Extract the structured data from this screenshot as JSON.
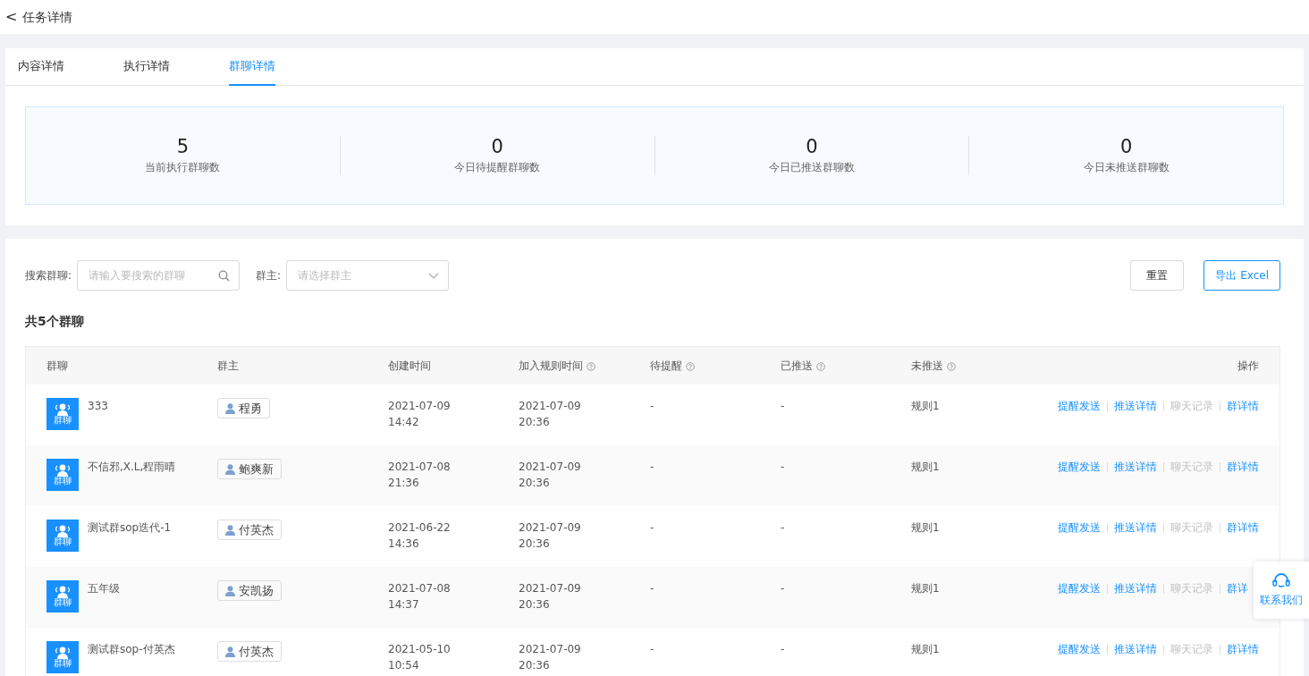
{
  "header": {
    "back_icon": "<",
    "title": "任务详情"
  },
  "tabs": [
    {
      "label": "内容详情",
      "selected": false
    },
    {
      "label": "执行详情",
      "selected": false
    },
    {
      "label": "群聊详情",
      "selected": true
    }
  ],
  "stats": [
    {
      "value": "5",
      "label": "当前执行群聊数"
    },
    {
      "value": "0",
      "label": "今日待提醒群聊数"
    },
    {
      "value": "0",
      "label": "今日已推送群聊数"
    },
    {
      "value": "0",
      "label": "今日未推送群聊数"
    }
  ],
  "filters": {
    "search_label": "搜索群聊:",
    "search_placeholder": "请输入要搜索的群聊",
    "owner_label": "群主:",
    "owner_placeholder": "请选择群主"
  },
  "buttons": [
    {
      "label": "重置",
      "kind": "default"
    },
    {
      "label": "导出 Excel",
      "kind": "outline"
    }
  ],
  "summary": "共5个群聊",
  "table": {
    "columns": [
      {
        "label": "群聊",
        "help": false
      },
      {
        "label": "群主",
        "help": false
      },
      {
        "label": "创建时间",
        "help": false
      },
      {
        "label": "加入规则时间",
        "help": true
      },
      {
        "label": "待提醒",
        "help": true
      },
      {
        "label": "已推送",
        "help": true
      },
      {
        "label": "未推送",
        "help": true
      },
      {
        "label": "操作",
        "help": false
      }
    ],
    "rows": [
      {
        "avatar_label": "群聊",
        "name": "333",
        "owner": "程勇",
        "created": [
          "2021-07-09",
          "14:42"
        ],
        "joined": [
          "2021-07-09",
          "20:36"
        ],
        "pending": "-",
        "pushed": "-",
        "unpushed": "规则1",
        "actions": [
          {
            "label": "提醒发送",
            "disabled": false
          },
          {
            "label": "推送详情",
            "disabled": false
          },
          {
            "label": "聊天记录",
            "disabled": true
          },
          {
            "label": "群详情",
            "disabled": false
          }
        ]
      },
      {
        "avatar_label": "群聊",
        "name": "不信邪,X.L,程雨晴",
        "owner": "鲍爽新",
        "created": [
          "2021-07-08",
          "21:36"
        ],
        "joined": [
          "2021-07-09",
          "20:36"
        ],
        "pending": "-",
        "pushed": "-",
        "unpushed": "规则1",
        "actions": [
          {
            "label": "提醒发送",
            "disabled": false
          },
          {
            "label": "推送详情",
            "disabled": false
          },
          {
            "label": "聊天记录",
            "disabled": true
          },
          {
            "label": "群详情",
            "disabled": false
          }
        ]
      },
      {
        "avatar_label": "群聊",
        "name": "测试群sop迭代-1",
        "owner": "付英杰",
        "created": [
          "2021-06-22",
          "14:36"
        ],
        "joined": [
          "2021-07-09",
          "20:36"
        ],
        "pending": "-",
        "pushed": "-",
        "unpushed": "规则1",
        "actions": [
          {
            "label": "提醒发送",
            "disabled": false
          },
          {
            "label": "推送详情",
            "disabled": false
          },
          {
            "label": "聊天记录",
            "disabled": true
          },
          {
            "label": "群详情",
            "disabled": false
          }
        ]
      },
      {
        "avatar_label": "群聊",
        "name": "五年级",
        "owner": "安凯扬",
        "created": [
          "2021-07-08",
          "14:37"
        ],
        "joined": [
          "2021-07-09",
          "20:36"
        ],
        "pending": "-",
        "pushed": "-",
        "unpushed": "规则1",
        "actions": [
          {
            "label": "提醒发送",
            "disabled": false
          },
          {
            "label": "推送详情",
            "disabled": false
          },
          {
            "label": "聊天记录",
            "disabled": true
          },
          {
            "label": "群详",
            "disabled": false
          }
        ]
      },
      {
        "avatar_label": "群聊",
        "name": "测试群sop-付英杰",
        "owner": "付英杰",
        "created": [
          "2021-05-10",
          "10:54"
        ],
        "joined": [
          "2021-07-09",
          "20:36"
        ],
        "pending": "-",
        "pushed": "-",
        "unpushed": "规则1",
        "actions": [
          {
            "label": "提醒发送",
            "disabled": false
          },
          {
            "label": "推送详情",
            "disabled": false
          },
          {
            "label": "聊天记录",
            "disabled": true
          },
          {
            "label": "群详情",
            "disabled": false
          }
        ]
      }
    ]
  },
  "contact_widget": {
    "label": "联系我们"
  }
}
